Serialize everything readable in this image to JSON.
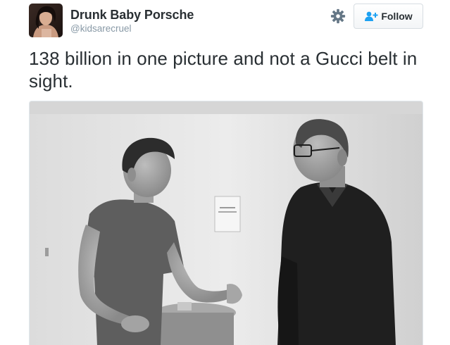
{
  "user": {
    "display_name": "Drunk Baby Porsche",
    "handle": "@kidsarecruel",
    "avatar_icon": "profile-avatar"
  },
  "actions": {
    "settings_icon": "gear-icon",
    "follow_label": "Follow",
    "follow_icon": "add-user-icon"
  },
  "tweet": {
    "text": "138 billion in one picture and not a Gucci belt in sight."
  },
  "media": {
    "type": "black-and-white photo",
    "subject": "two men talking in a room"
  },
  "colors": {
    "text_primary": "#292f33",
    "text_secondary": "#8899a6",
    "follow_icon": "#1da1f2",
    "gear": "#657786"
  }
}
